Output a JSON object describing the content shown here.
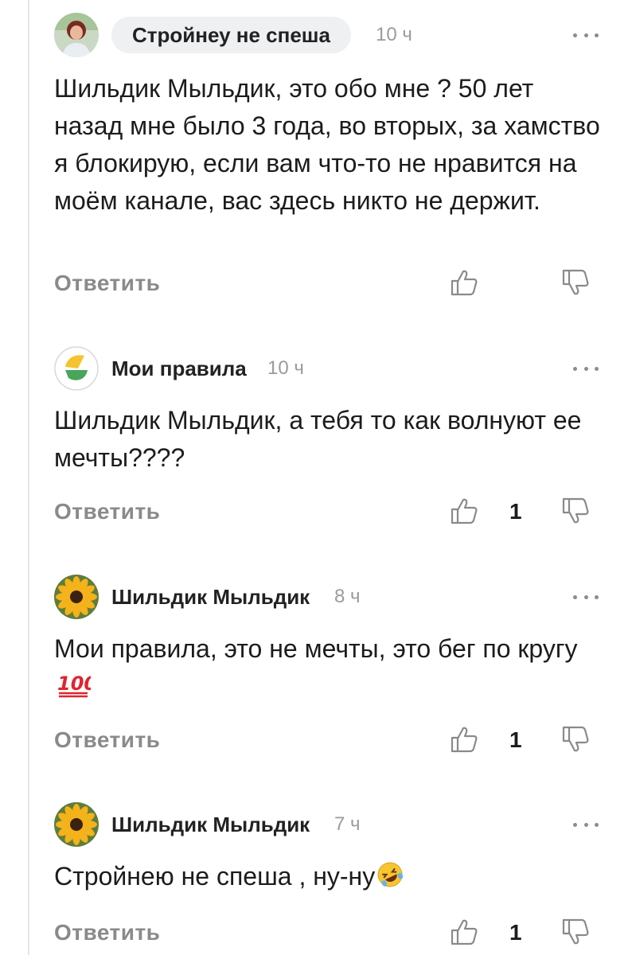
{
  "comments": [
    {
      "author": "Стройнеу не спеша",
      "time": "10 ч",
      "text": "Шильдик Мыльдик, это обо мне ? 50 лет назад мне было 3 года, во вторых, за хамство я блокирую, если вам что-то не нравится на моём канале, вас здесь никто не держит.",
      "reply_label": "Ответить",
      "likes": ""
    },
    {
      "author": "Мои правила",
      "time": "10 ч",
      "text": "Шильдик Мыльдик, а тебя то как волнуют ее мечты????",
      "reply_label": "Ответить",
      "likes": "1"
    },
    {
      "author": "Шильдик Мыльдик",
      "time": "8 ч",
      "text": "Мои правила,  это не мечты, это бег по кругу",
      "reply_label": "Ответить",
      "likes": "1",
      "emoji": "hundred-points-emoji"
    },
    {
      "author": "Шильдик Мыльдик",
      "time": "7 ч",
      "text": "Стройнею не спеша ,  ну-ну",
      "reply_label": "Ответить",
      "likes": "1",
      "emoji": "rolling-on-floor-laughing-emoji"
    }
  ],
  "icons": {
    "more": "more-icon",
    "like": "thumbs-up-icon",
    "dislike": "thumbs-down-icon"
  },
  "colors": {
    "chip_bg": "#eef0f2",
    "muted": "#8a8a8a",
    "timestamp": "#9b9b9b",
    "text": "#1c1c1c"
  }
}
